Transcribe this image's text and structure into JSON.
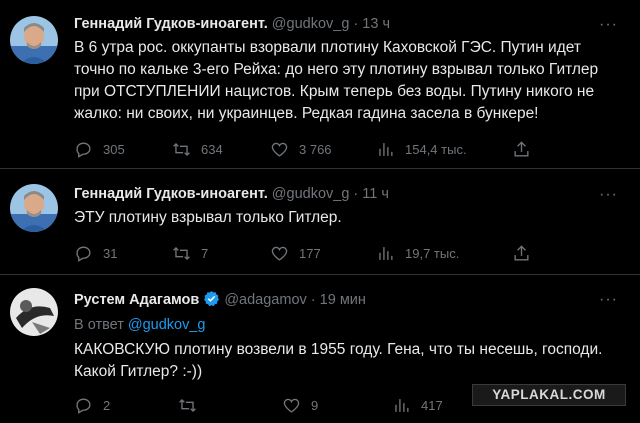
{
  "tweets": [
    {
      "author_name": "Геннадий Гудков-иноагент.",
      "handle": "@gudkov_g",
      "separator": "·",
      "time": "13 ч",
      "text_lines": [
        "В 6 утра рос. оккупанты взорвали плотину Каховской ГЭС. Путин идет",
        "точно по кальке 3-его Рейха: до него эту плотину взрывал только Гитлер",
        "при ОТСТУПЛЕНИИ нацистов. Крым теперь без воды. Путину никого не",
        "жалко: ни своих, ни украинцев. Редкая гадина засела в бункере!"
      ],
      "replies": "305",
      "retweets": "634",
      "likes": "3 766",
      "views": "154,4 тыс."
    },
    {
      "author_name": "Геннадий Гудков-иноагент.",
      "handle": "@gudkov_g",
      "separator": "·",
      "time": "11 ч",
      "text_lines": [
        "ЭТУ плотину взрывал только Гитлер."
      ],
      "replies": "31",
      "retweets": "7",
      "likes": "177",
      "views": "19,7 тыс."
    },
    {
      "author_name": "Рустем Адагамов",
      "handle": "@adagamov",
      "separator": "·",
      "time": "19 мин",
      "reply_prefix": "В ответ",
      "reply_to": "@gudkov_g",
      "text_lines": [
        "КАКОВСКУЮ плотину возвели в 1955 году. Гена, что ты несешь, господи.",
        "Какой Гитлер? :-))"
      ],
      "replies": "2",
      "retweets": "",
      "likes": "9",
      "views": "417"
    }
  ],
  "more_glyph": "···",
  "watermark": "YAPLAKAL.COM",
  "colors": {
    "background": "#000000",
    "text": "#e7e9ea",
    "muted": "#71767b",
    "link": "#1d9bf0",
    "verified": "#1d9bf0"
  },
  "icons": [
    "reply-icon",
    "retweet-icon",
    "like-icon",
    "views-icon",
    "share-icon",
    "verified-badge-icon",
    "more-icon"
  ]
}
